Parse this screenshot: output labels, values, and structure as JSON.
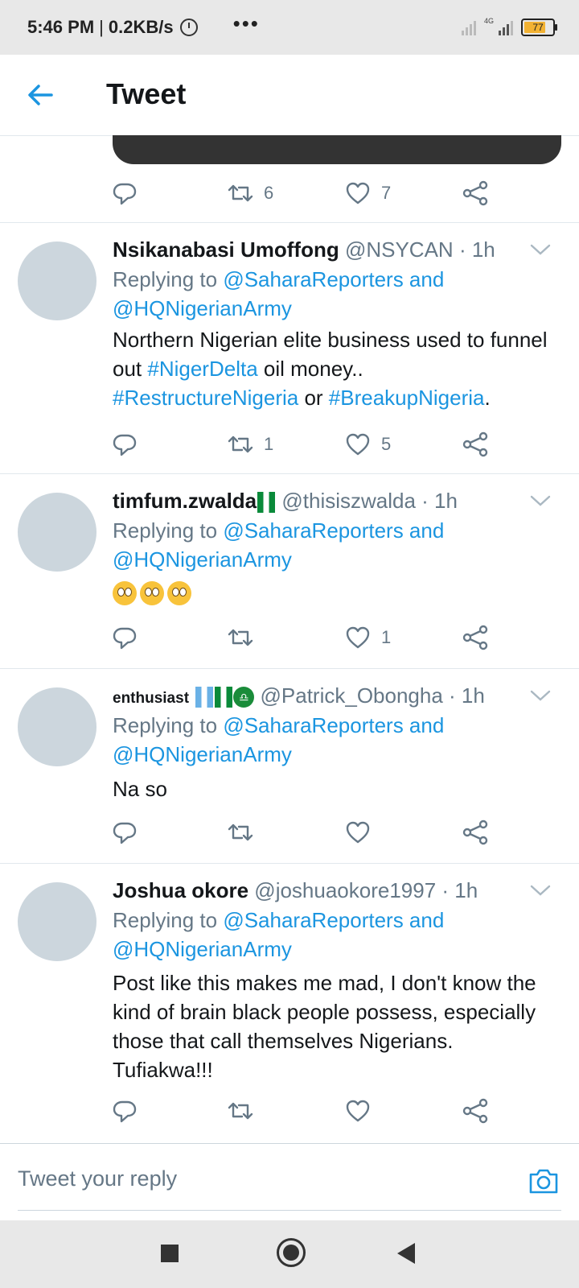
{
  "status_bar": {
    "time": "5:46 PM",
    "separator": "|",
    "speed": "0.2KB/s",
    "dots": "•••",
    "network_label": "4G",
    "battery": "77"
  },
  "header": {
    "title": "Tweet"
  },
  "prev_tweet_actions": {
    "retweets": "6",
    "likes": "7"
  },
  "tweets": [
    {
      "name": "Nsikanabasi Umoffong",
      "handle": "@NSYCAN",
      "time": "· 1h",
      "replying_prefix": "Replying to",
      "replying_to": "@SaharaReporters and @HQNigerianArmy",
      "text_parts": {
        "p1": "Northern Nigerian elite business used to funnel out  ",
        "tag1": "#NigerDelta",
        "p2": " oil money.. ",
        "tag2": "#RestructureNigeria",
        "p3": " or ",
        "tag3": "#BreakupNigeria",
        "p4": "."
      },
      "retweets": "1",
      "likes": "5"
    },
    {
      "name": "timfum.zwalda",
      "handle": "@thisiszwalda",
      "time": "· 1h",
      "replying_prefix": "Replying to",
      "replying_to": "@SaharaReporters and @HQNigerianArmy",
      "emoji": "rolling-eyes-emoji",
      "retweets": "",
      "likes": "1"
    },
    {
      "name": "enthusiast",
      "handle": "@Patrick_Obongha",
      "time": "· 1h",
      "replying_prefix": "Replying to",
      "replying_to": "@SaharaReporters and @HQNigerianArmy",
      "text": "Na so",
      "retweets": "",
      "likes": ""
    },
    {
      "name": "Joshua okore",
      "handle": "@joshuaokore1997",
      "time": "· 1h",
      "replying_prefix": "Replying to",
      "replying_to": "@SaharaReporters and @HQNigerianArmy",
      "text": "Post like this makes me mad, I don't know the kind of brain black people possess, especially those that call themselves Nigerians. Tufiakwa!!!",
      "retweets": "",
      "likes": ""
    }
  ],
  "reply_bar": {
    "placeholder": "Tweet your reply"
  },
  "colors": {
    "accent": "#1b95e0",
    "muted": "#657786",
    "avatar": "#ccd6dd"
  }
}
